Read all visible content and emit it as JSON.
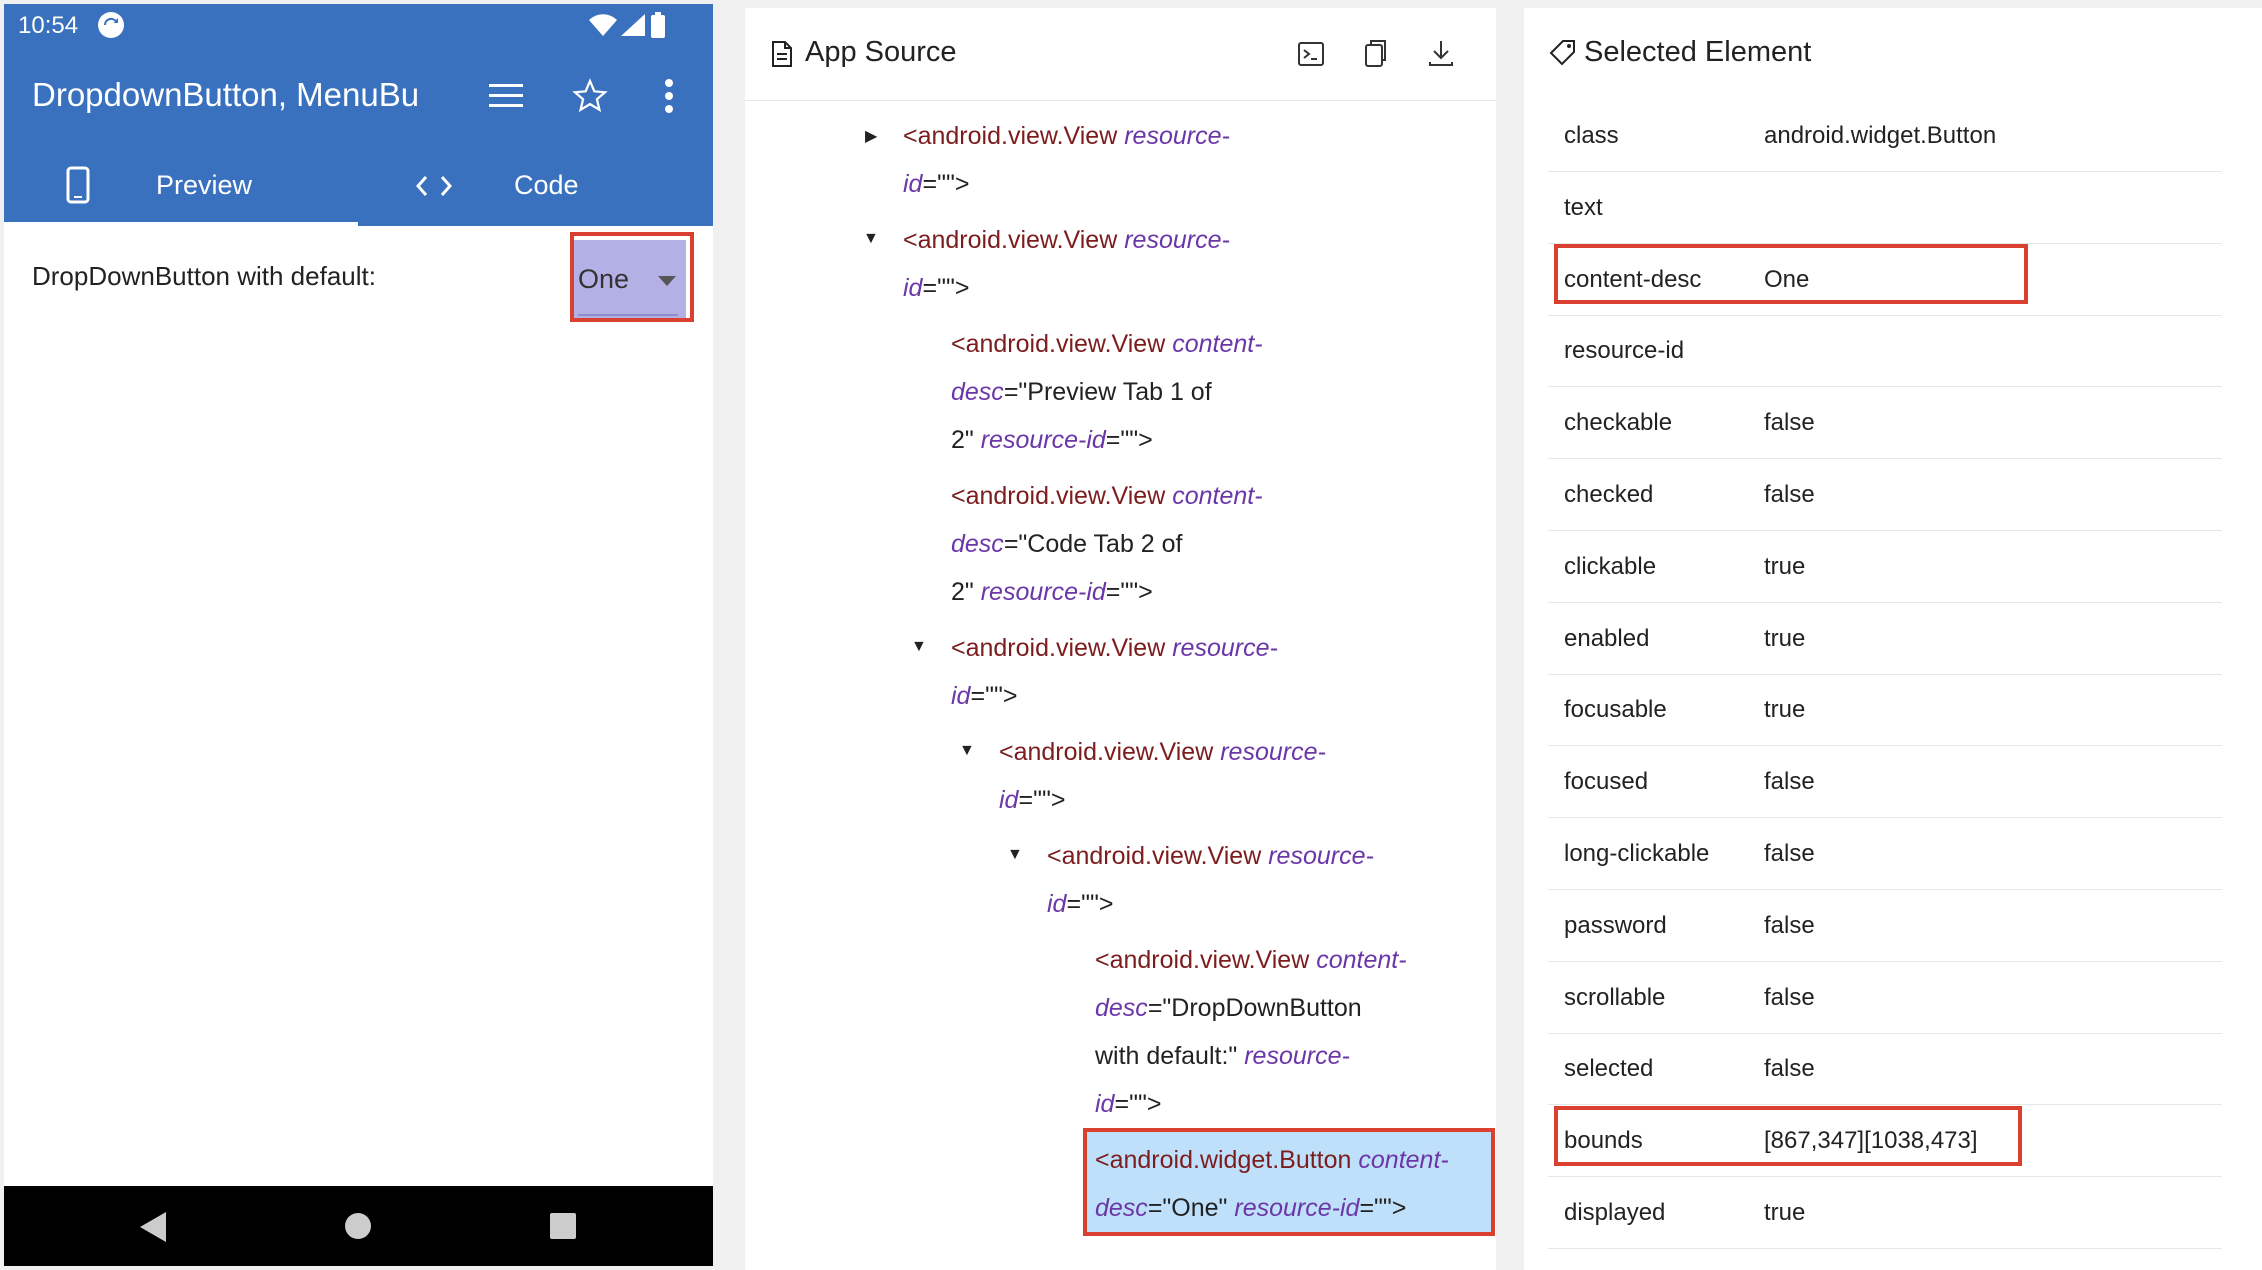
{
  "phone": {
    "status_time": "10:54",
    "title": "DropdownButton, MenuBu",
    "tabs": [
      {
        "label": "Preview",
        "icon": "phone-icon"
      },
      {
        "label": "Code",
        "icon": "code-icon"
      }
    ],
    "dropdown_label": "DropDownButton with default:",
    "dropdown_value": "One"
  },
  "source": {
    "title": "App Source",
    "lines": [
      {
        "t": "<android.view.View ",
        "a": "resource-"
      },
      {
        "a": "id",
        "t": "=\"\">"
      },
      {
        "t": "<android.view.View ",
        "a": "resource-"
      },
      {
        "a": "id",
        "t": "=\"\">"
      },
      {
        "t": "<android.view.View ",
        "a": "content-"
      },
      {
        "a": "desc",
        "t": "=\"Preview Tab 1 of"
      },
      {
        "t": "2\" ",
        "a": "resource-id",
        "t2": "=\"\">"
      },
      {
        "t": "<android.view.View ",
        "a": "content-"
      },
      {
        "a": "desc",
        "t": "=\"Code Tab 2 of"
      },
      {
        "t": "2\" ",
        "a": "resource-id",
        "t2": "=\"\">"
      },
      {
        "t": "<android.view.View ",
        "a": "resource-"
      },
      {
        "a": "id",
        "t": "=\"\">"
      },
      {
        "t": "<android.view.View ",
        "a": "resource-"
      },
      {
        "a": "id",
        "t": "=\"\">"
      },
      {
        "t": "<android.view.View ",
        "a": "resource-"
      },
      {
        "a": "id",
        "t": "=\"\">"
      },
      {
        "t": "<android.view.View ",
        "a": "content-"
      },
      {
        "a": "desc",
        "t": "=\"DropDownButton"
      },
      {
        "t": "with default:\" ",
        "a": "resource-"
      },
      {
        "a": "id",
        "t": "=\"\">"
      },
      {
        "t": "<android.widget.Button ",
        "a": "content-"
      },
      {
        "a": "desc",
        "t": "=\"One\" ",
        "a2": "resource-id",
        "t2": "=\"\">"
      }
    ]
  },
  "selected": {
    "title": "Selected Element",
    "props": [
      {
        "key": "class",
        "value": "android.widget.Button"
      },
      {
        "key": "text",
        "value": ""
      },
      {
        "key": "content-desc",
        "value": "One"
      },
      {
        "key": "resource-id",
        "value": ""
      },
      {
        "key": "checkable",
        "value": "false"
      },
      {
        "key": "checked",
        "value": "false"
      },
      {
        "key": "clickable",
        "value": "true"
      },
      {
        "key": "enabled",
        "value": "true"
      },
      {
        "key": "focusable",
        "value": "true"
      },
      {
        "key": "focused",
        "value": "false"
      },
      {
        "key": "long-clickable",
        "value": "false"
      },
      {
        "key": "password",
        "value": "false"
      },
      {
        "key": "scrollable",
        "value": "false"
      },
      {
        "key": "selected",
        "value": "false"
      },
      {
        "key": "bounds",
        "value": "[867,347][1038,473]"
      },
      {
        "key": "displayed",
        "value": "true"
      }
    ]
  },
  "colors": {
    "appbar": "#3a71be",
    "highlight_box": "#d9402f",
    "selected_node": "#bfe0fa",
    "tag": "#7c1d1d",
    "attr": "#6b36a8"
  }
}
